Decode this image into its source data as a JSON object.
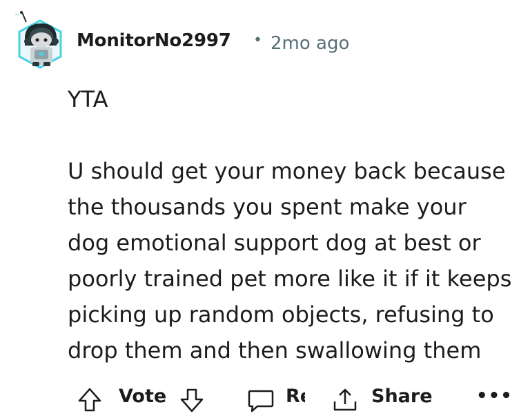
{
  "comment": {
    "author": "MonitorNo2997",
    "separator": "•",
    "timestamp": "2mo ago",
    "avatar_icon": "snoo-avatar-icon",
    "body": {
      "line1": "YTA",
      "paragraph2": [
        "U should get your money back because",
        "the thousands you spent make your",
        "dog emotional support dog at best or",
        "poorly trained pet more like it if it keeps",
        "picking up random objects, refusing to",
        "drop them and then swallowing them"
      ]
    },
    "actions": {
      "upvote_icon": "arrow-up-icon",
      "vote_label": "Vote",
      "downvote_icon": "arrow-down-icon",
      "reply_icon": "comment-bubble-icon",
      "reply_label": "Reply",
      "share_icon": "share-icon",
      "share_label": "Share",
      "more_label": "•••"
    }
  },
  "colors": {
    "text": "#1c1c1c",
    "meta": "#576f76",
    "avatar_ring": "#46d1e6"
  }
}
